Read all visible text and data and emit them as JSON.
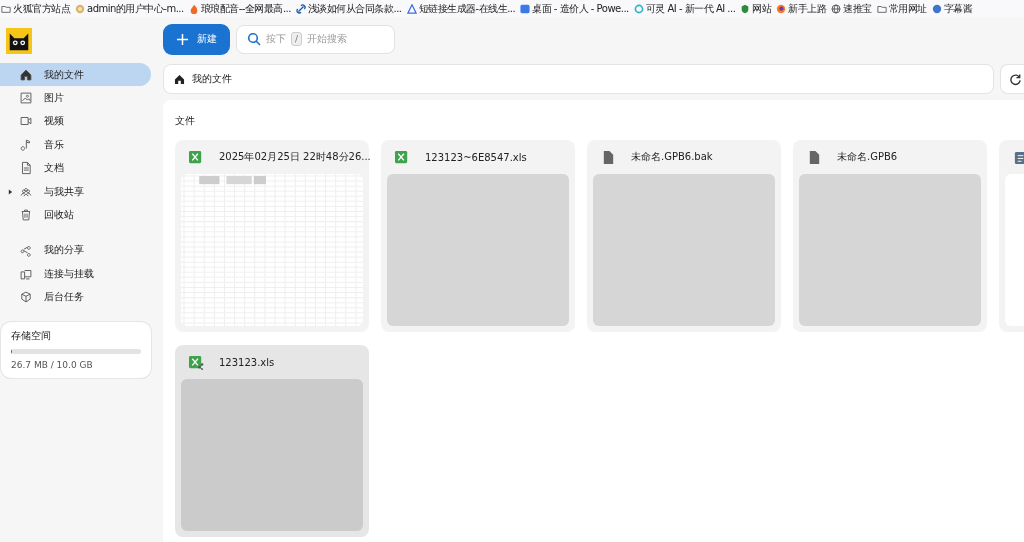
{
  "bookmarks": [
    {
      "label": "火狐官方站点"
    },
    {
      "label": "admin的用户中心-m..."
    },
    {
      "label": "琅琅配音--全网最高..."
    },
    {
      "label": "浅谈如何从合同条款..."
    },
    {
      "label": "短链接生成器-在线生..."
    },
    {
      "label": "桌面 - 造价人 - Powe..."
    },
    {
      "label": "可灵 AI - 新一代 AI ..."
    },
    {
      "label": "网站"
    },
    {
      "label": "新手上路"
    },
    {
      "label": "速推宝"
    },
    {
      "label": "常用网址"
    },
    {
      "label": "字幕酱"
    }
  ],
  "new_button": "新建",
  "search": {
    "placeholder_before": "按下",
    "key": "/",
    "placeholder_after": "开始搜索"
  },
  "sidebar": {
    "items": [
      {
        "label": "我的文件",
        "selected": true
      },
      {
        "label": "图片",
        "selected": false
      },
      {
        "label": "视频",
        "selected": false
      },
      {
        "label": "音乐",
        "selected": false
      },
      {
        "label": "文档",
        "selected": false
      },
      {
        "label": "与我共享",
        "selected": false,
        "expandable": true
      },
      {
        "label": "回收站",
        "selected": false
      }
    ],
    "tools": [
      {
        "label": "我的分享",
        "selected": false
      },
      {
        "label": "连接与挂载",
        "selected": false
      },
      {
        "label": "后台任务",
        "selected": false
      }
    ]
  },
  "storage": {
    "title": "存储空间",
    "level": 0.003,
    "reading": "26.7 MB / 10.0 GB"
  },
  "breadcrumb": "我的文件",
  "section_title": "文件",
  "files": [
    {
      "name": "2025年02月25日 22时48分26...",
      "kind": "excel",
      "selected": false
    },
    {
      "name": "123123~6E8547.xls",
      "kind": "excel",
      "selected": false
    },
    {
      "name": "未命名.GPB6.bak",
      "kind": "file",
      "selected": false
    },
    {
      "name": "未命名.GPB6",
      "kind": "file",
      "selected": false
    },
    {
      "kind": "note",
      "selected": false
    },
    {
      "name": "123123.xls",
      "kind": "excel",
      "shared": true,
      "selected": true
    }
  ]
}
